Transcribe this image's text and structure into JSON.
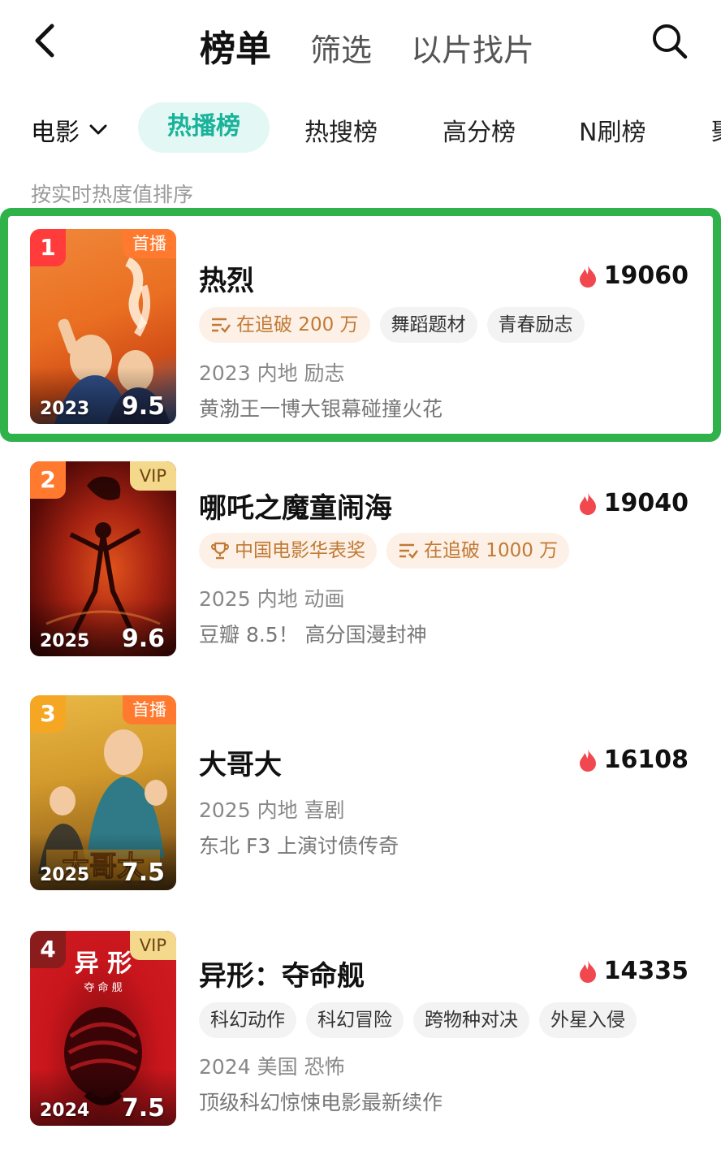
{
  "header": {
    "tabs": [
      {
        "label": "榜单",
        "active": true
      },
      {
        "label": "筛选",
        "active": false
      },
      {
        "label": "以片找片",
        "active": false
      }
    ]
  },
  "category": {
    "selected": "电影",
    "tabs": [
      "热播榜",
      "热搜榜",
      "高分榜",
      "N刷榜",
      "聚"
    ],
    "active_index": 0
  },
  "sort_hint": "按实时热度值排序",
  "items": [
    {
      "rank": "1",
      "rank_color": "#ff3b3b",
      "badge": "首播",
      "badge_type": "shou",
      "year": "2023",
      "score": "9.5",
      "title": "热烈",
      "heat": "19060",
      "tags": [
        {
          "label": "在追破 200 万",
          "style": "hot",
          "icon": "following-icon"
        },
        {
          "label": "舞蹈题材",
          "style": "plain"
        },
        {
          "label": "青春励志",
          "style": "plain"
        }
      ],
      "meta": "2023 内地 励志",
      "desc": "黄渤王一博大银幕碰撞火花",
      "poster_colors": [
        "#ec7a2e",
        "#f2a14a",
        "#3c5a8c"
      ]
    },
    {
      "rank": "2",
      "rank_color": "#ff7a2f",
      "badge": "VIP",
      "badge_type": "vip",
      "year": "2025",
      "score": "9.6",
      "title": "哪吒之魔童闹海",
      "heat": "19040",
      "tags": [
        {
          "label": "中国电影华表奖",
          "style": "hot",
          "icon": "trophy-icon"
        },
        {
          "label": "在追破 1000 万",
          "style": "hot",
          "icon": "following-icon"
        }
      ],
      "meta": "2025 内地 动画",
      "desc": "豆瓣 8.5！ 高分国漫封神",
      "poster_colors": [
        "#7a120c",
        "#c23a16",
        "#2a0806"
      ]
    },
    {
      "rank": "3",
      "rank_color": "#f5a623",
      "badge": "首播",
      "badge_type": "shou",
      "year": "2025",
      "score": "7.5",
      "title": "大哥大",
      "heat": "16108",
      "tags": [],
      "meta": "2025 内地 喜剧",
      "desc": "东北 F3 上演讨债传奇",
      "poster_colors": [
        "#d9a233",
        "#8a5a1c",
        "#2f6e7a"
      ]
    },
    {
      "rank": "4",
      "rank_color": "#8a1c1c",
      "badge": "VIP",
      "badge_type": "vip",
      "year": "2024",
      "score": "7.5",
      "title": "异形：夺命舰",
      "heat": "14335",
      "tags": [
        {
          "label": "科幻动作",
          "style": "plain"
        },
        {
          "label": "科幻冒险",
          "style": "plain"
        },
        {
          "label": "跨物种对决",
          "style": "plain"
        },
        {
          "label": "外星入侵",
          "style": "plain"
        }
      ],
      "meta": "2024 美国 恐怖",
      "desc": "顶级科幻惊悚电影最新续作",
      "poster_colors": [
        "#c8161c",
        "#7a0b0e",
        "#2a0304"
      ]
    }
  ]
}
